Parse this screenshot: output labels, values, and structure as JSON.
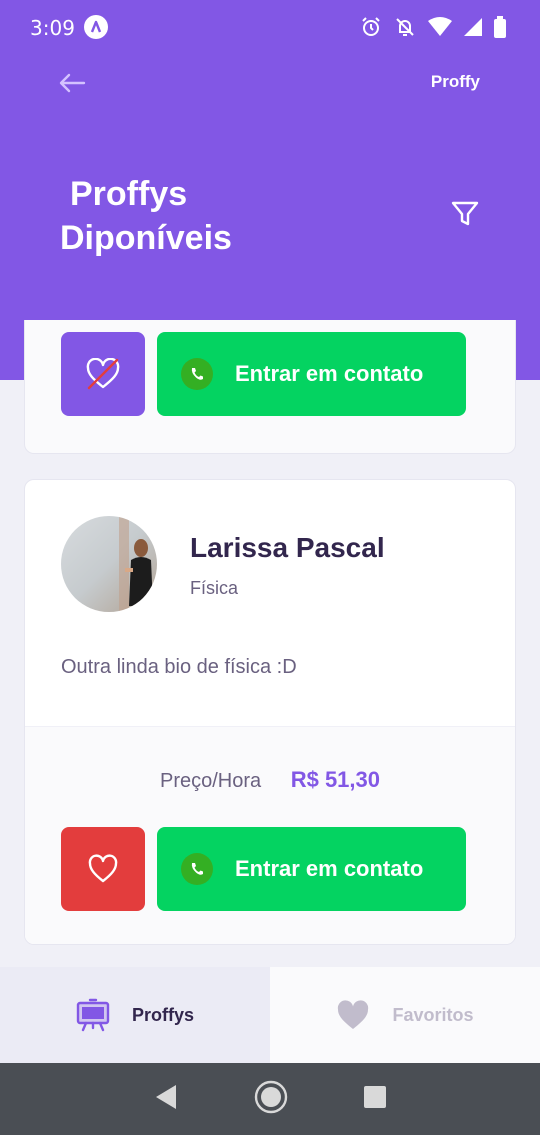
{
  "status": {
    "time": "3:09"
  },
  "header": {
    "logo": "Proffy",
    "title_line1": "Proffys",
    "title_line2": "Diponíveis"
  },
  "cards": [
    {
      "contact_label": "Entrar em contato",
      "favorited": true
    },
    {
      "name": "Larissa Pascal",
      "subject": "Física",
      "bio": "Outra linda bio de física :D",
      "price_label": "Preço/Hora",
      "price_value": "R$ 51,30",
      "contact_label": "Entrar em contato",
      "favorited": false
    }
  ],
  "colors": {
    "primary": "#8257e5",
    "green": "#04d361",
    "red": "#e33d3d",
    "text_title": "#32264d",
    "text_base": "#6a6180"
  },
  "tabs": [
    {
      "label": "Proffys",
      "icon": "easel-icon",
      "active": true
    },
    {
      "label": "Favoritos",
      "icon": "heart-icon",
      "active": false
    }
  ]
}
